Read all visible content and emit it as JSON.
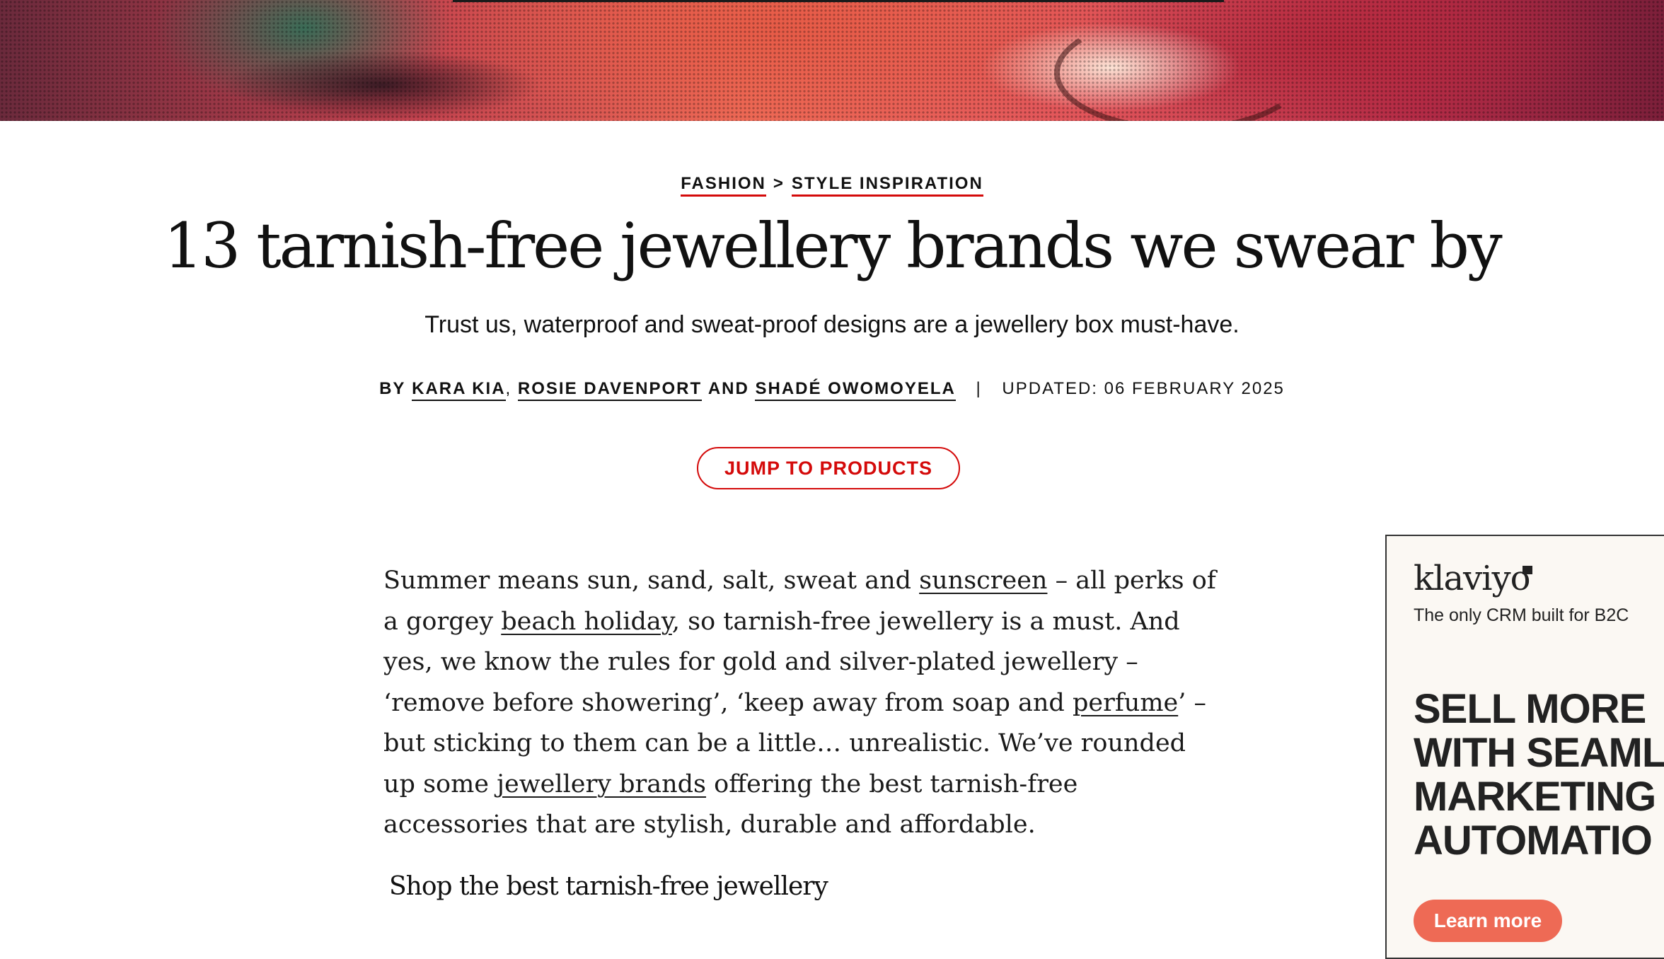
{
  "colors": {
    "accent": "#d40a0a",
    "ad_cta": "#ee6a55"
  },
  "breadcrumb": {
    "section": "FASHION",
    "separator": ">",
    "subsection": "STYLE INSPIRATION"
  },
  "article": {
    "title": "13 tarnish-free jewellery brands we swear by",
    "subtitle": "Trust us, waterproof and sweat-proof designs are a jewellery box must-have.",
    "byline": {
      "by": "BY",
      "author1": "KARA KIA",
      "comma": ",",
      "author2": "ROSIE DAVENPORT",
      "and": "AND",
      "author3": "SHADÉ OWOMOYELA",
      "divider": "|",
      "updated": "UPDATED: 06 FEBRUARY 2025"
    },
    "jump_button": "JUMP TO PRODUCTS",
    "body": {
      "t1": "Summer means sun, sand, salt, sweat and ",
      "link_sunscreen": "sunscreen",
      "t2": " – all perks of a gorgey ",
      "link_beach": "beach holiday",
      "t3": ", so tarnish-free jewellery is a must. And yes, we know the rules for gold and silver-plated jewellery – ‘remove before showering’, ‘keep away from soap and ",
      "link_perfume": "perfume",
      "t4": "’ – but sticking to them can be a little… unrealistic. We’ve rounded up some ",
      "link_brands": "jewellery brands",
      "t5": " offering the best tarnish-free accessories that are stylish, durable and affordable."
    },
    "shop_heading": "Shop the best tarnish-free jewellery"
  },
  "ad": {
    "logo": "klaviyo",
    "tagline": "The only CRM built for B2C",
    "headline": "SELL MORE\nWITH SEAML\nMARKETING\nAUTOMATIO",
    "cta": "Learn more"
  }
}
